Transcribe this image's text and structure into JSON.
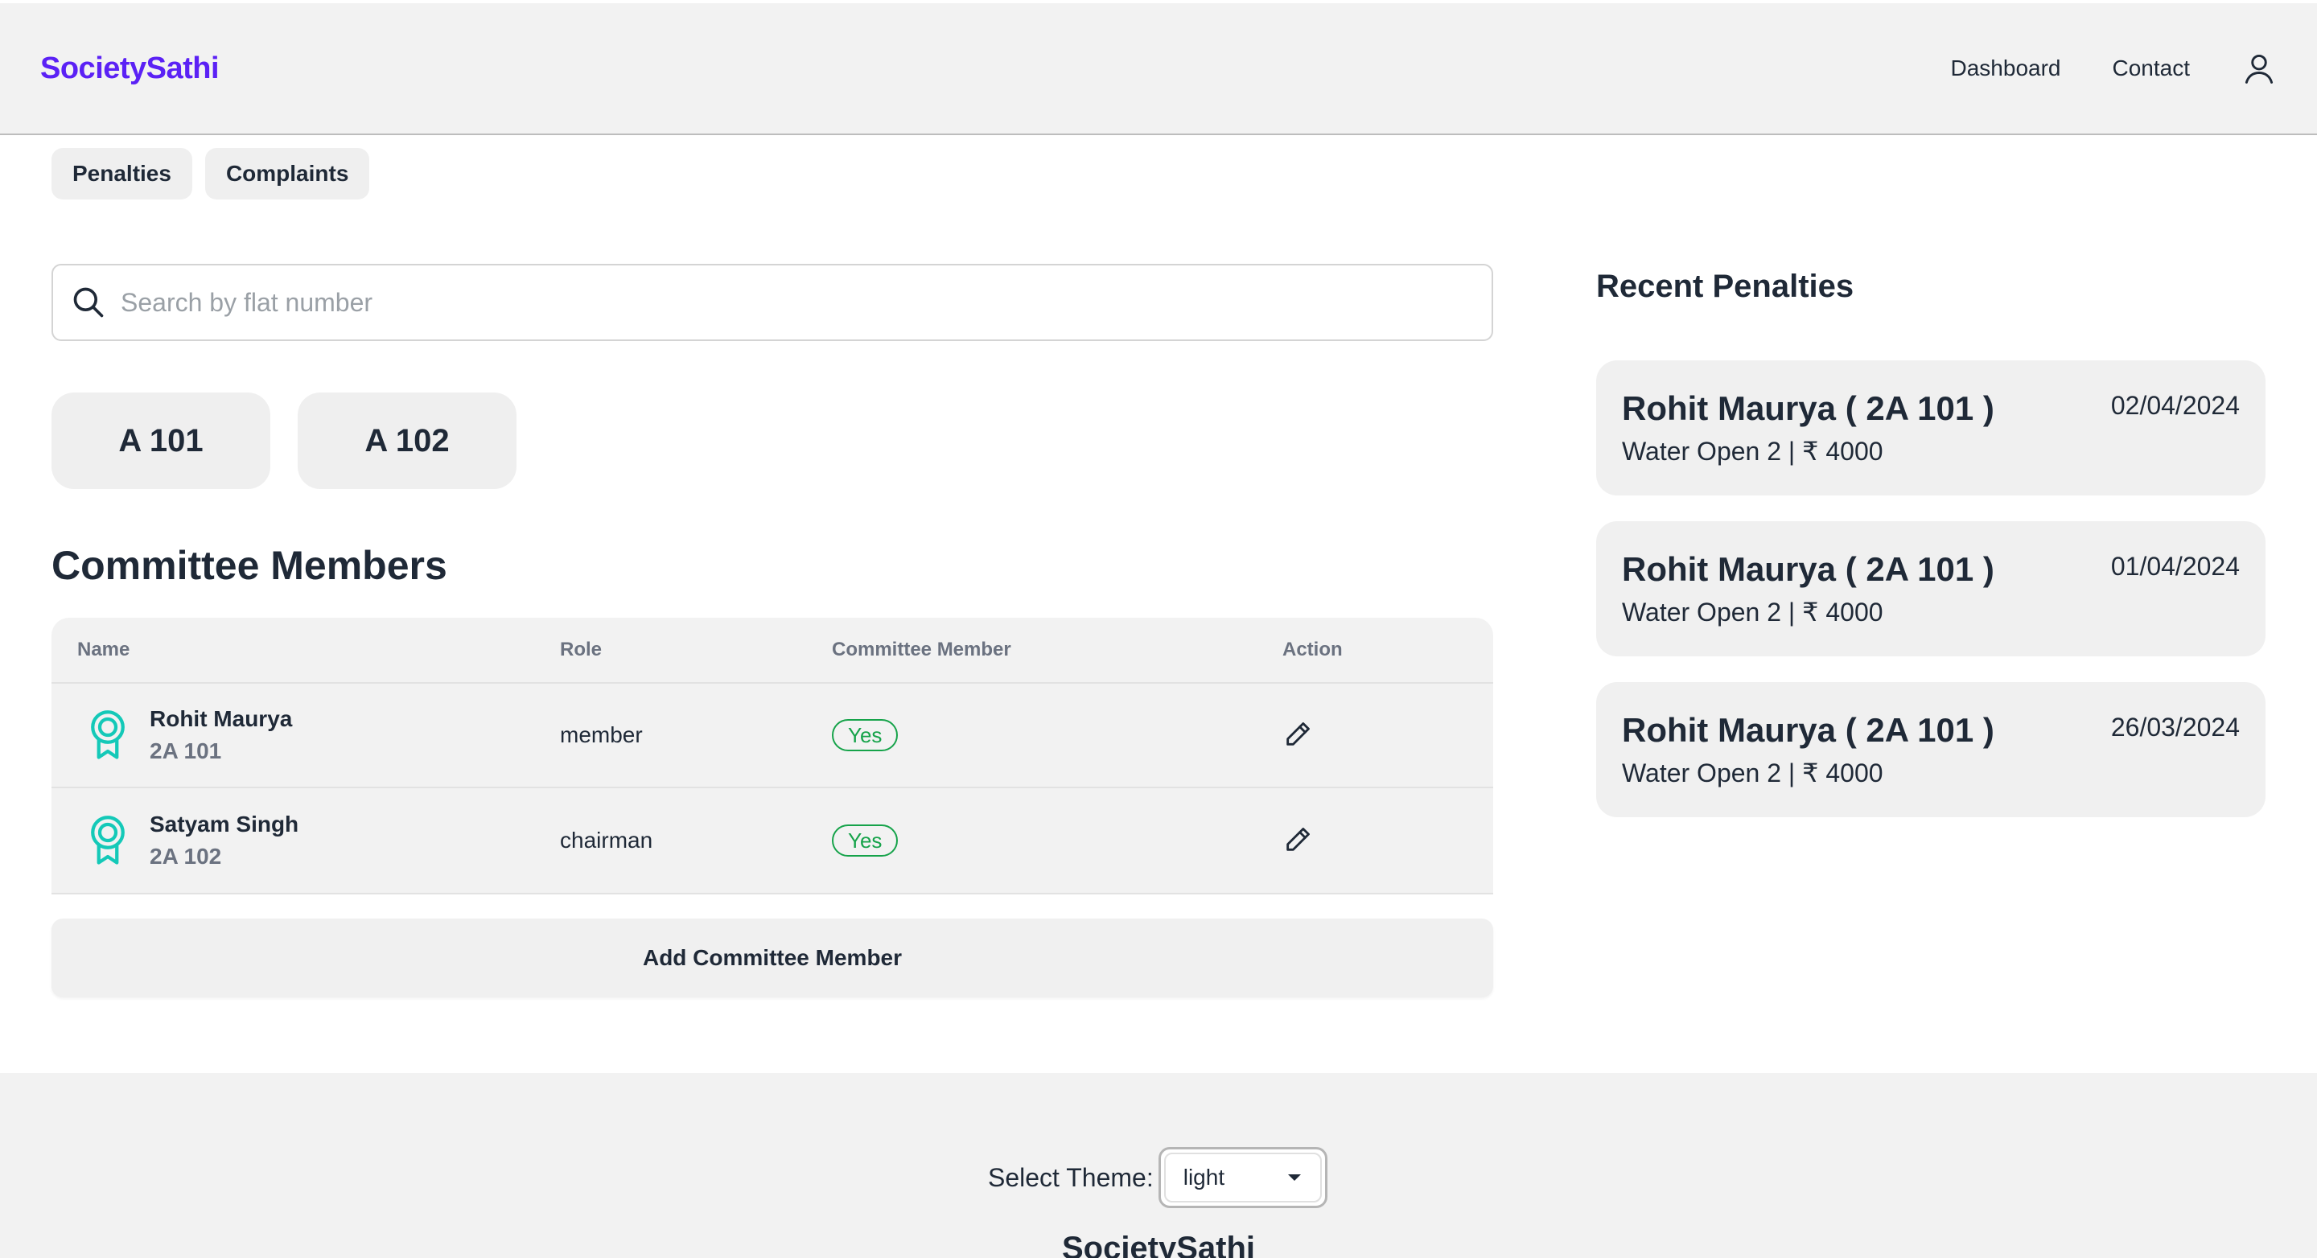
{
  "header": {
    "brand": "SocietySathi",
    "nav": [
      "Dashboard",
      "Contact"
    ],
    "user_icon": "user-icon"
  },
  "tabs": [
    "Penalties",
    "Complaints"
  ],
  "search": {
    "placeholder": "Search by flat number",
    "value": ""
  },
  "flats": [
    "A 101",
    "A 102"
  ],
  "committee": {
    "title": "Committee Members",
    "columns": [
      "Name",
      "Role",
      "Committee Member",
      "Action"
    ],
    "rows": [
      {
        "name": "Rohit Maurya",
        "flat": "2A 101",
        "role": "member",
        "committee": "Yes"
      },
      {
        "name": "Satyam Singh",
        "flat": "2A 102",
        "role": "chairman",
        "committee": "Yes"
      }
    ],
    "add_label": "Add Committee Member"
  },
  "recent_penalties": {
    "title": "Recent Penalties",
    "items": [
      {
        "name": "Rohit Maurya ( 2A 101 )",
        "date": "02/04/2024",
        "detail": "Water Open 2 | ₹ 4000"
      },
      {
        "name": "Rohit Maurya ( 2A 101 )",
        "date": "01/04/2024",
        "detail": "Water Open 2 | ₹ 4000"
      },
      {
        "name": "Rohit Maurya ( 2A 101 )",
        "date": "26/03/2024",
        "detail": "Water Open 2 | ₹ 4000"
      }
    ]
  },
  "footer": {
    "theme_label": "Select Theme:",
    "theme_value": "light",
    "brand": "SocietySathi"
  },
  "colors": {
    "brand": "#5b21f5",
    "award": "#14c9b8",
    "badge": "#16a34a"
  }
}
